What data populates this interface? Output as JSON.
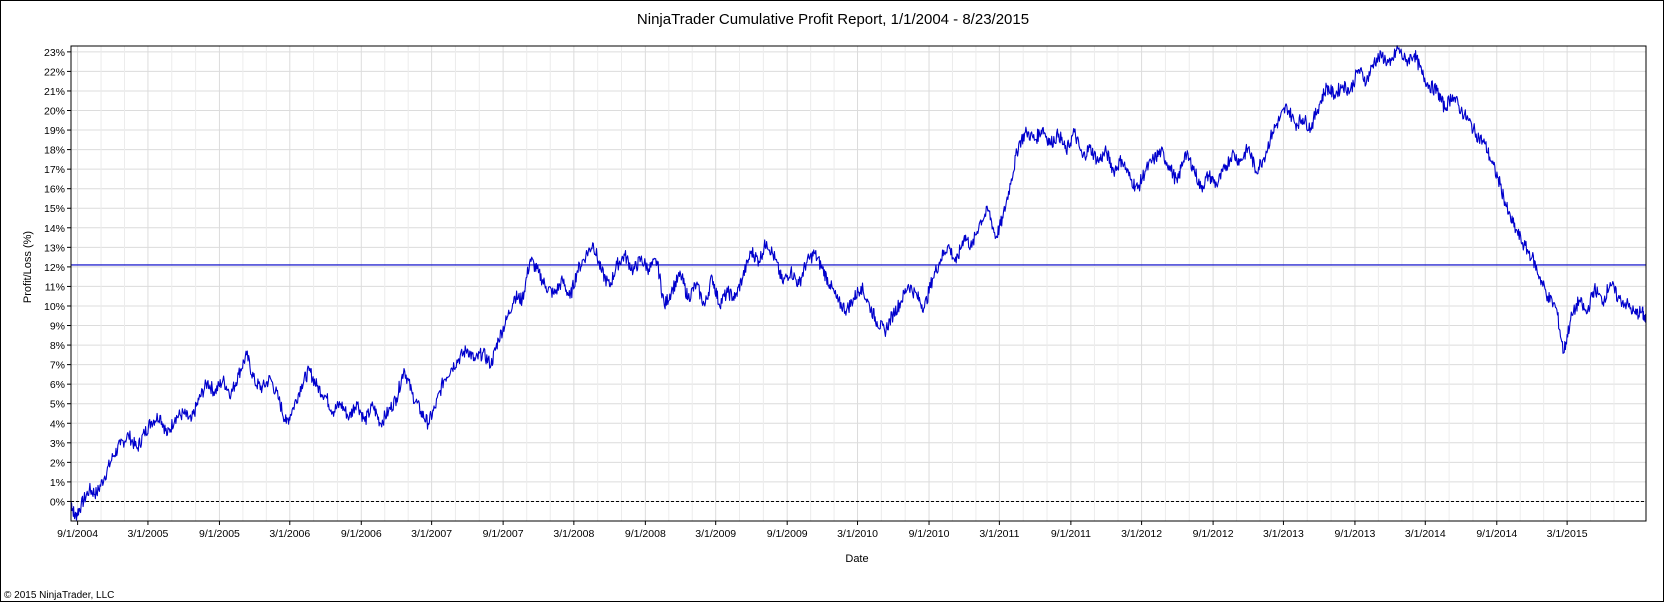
{
  "chart_data": {
    "type": "line",
    "title": "NinjaTrader Cumulative Profit Report, 1/1/2004 - 8/23/2015",
    "xlabel": "Date",
    "ylabel": "Profit/Loss (%)",
    "ylim": [
      -1,
      23.3
    ],
    "xlim": [
      "2004-08-15",
      "2015-09-20"
    ],
    "grid": true,
    "legend": "none",
    "x_ticks": [
      "9/1/2004",
      "3/1/2005",
      "9/1/2005",
      "3/1/2006",
      "9/1/2006",
      "3/1/2007",
      "9/1/2007",
      "3/1/2008",
      "9/1/2008",
      "3/1/2009",
      "9/1/2009",
      "3/1/2010",
      "9/1/2010",
      "3/1/2011",
      "9/1/2011",
      "3/1/2012",
      "9/1/2012",
      "3/1/2013",
      "9/1/2013",
      "3/1/2014",
      "9/1/2014",
      "3/1/2015"
    ],
    "y_ticks": [
      "0%",
      "1%",
      "2%",
      "3%",
      "4%",
      "5%",
      "6%",
      "7%",
      "8%",
      "9%",
      "10%",
      "11%",
      "12%",
      "13%",
      "14%",
      "15%",
      "16%",
      "17%",
      "18%",
      "19%",
      "20%",
      "21%",
      "22%",
      "23%"
    ],
    "reference_lines": [
      {
        "value": 12.1,
        "style": "solid",
        "color": "#2b2bd0"
      },
      {
        "value": 0,
        "style": "dashed",
        "color": "#000000"
      }
    ],
    "series": [
      {
        "color": "#0000cc",
        "points": [
          [
            "2004-08-15",
            0.0
          ],
          [
            "2004-08-25",
            -0.8
          ],
          [
            "2004-09-10",
            -0.2
          ],
          [
            "2004-10-01",
            0.6
          ],
          [
            "2004-10-20",
            0.4
          ],
          [
            "2004-11-10",
            1.3
          ],
          [
            "2004-12-01",
            2.3
          ],
          [
            "2004-12-20",
            2.9
          ],
          [
            "2005-01-10",
            3.4
          ],
          [
            "2005-02-01",
            2.7
          ],
          [
            "2005-02-20",
            3.5
          ],
          [
            "2005-03-10",
            4.1
          ],
          [
            "2005-04-01",
            4.4
          ],
          [
            "2005-04-20",
            3.4
          ],
          [
            "2005-05-10",
            4.3
          ],
          [
            "2005-06-01",
            4.5
          ],
          [
            "2005-06-20",
            4.1
          ],
          [
            "2005-07-10",
            5.2
          ],
          [
            "2005-08-01",
            6.1
          ],
          [
            "2005-08-20",
            5.6
          ],
          [
            "2005-09-10",
            6.2
          ],
          [
            "2005-10-01",
            5.5
          ],
          [
            "2005-10-20",
            6.5
          ],
          [
            "2005-11-10",
            7.5
          ],
          [
            "2005-12-01",
            6.1
          ],
          [
            "2005-12-20",
            5.8
          ],
          [
            "2006-01-10",
            6.3
          ],
          [
            "2006-02-01",
            5.2
          ],
          [
            "2006-02-20",
            4.0
          ],
          [
            "2006-03-10",
            4.8
          ],
          [
            "2006-04-01",
            6.0
          ],
          [
            "2006-04-20",
            6.7
          ],
          [
            "2006-05-10",
            5.9
          ],
          [
            "2006-06-01",
            5.4
          ],
          [
            "2006-06-20",
            4.6
          ],
          [
            "2006-07-10",
            5.0
          ],
          [
            "2006-08-01",
            4.3
          ],
          [
            "2006-08-20",
            5.1
          ],
          [
            "2006-09-10",
            4.1
          ],
          [
            "2006-10-01",
            4.9
          ],
          [
            "2006-10-20",
            4.0
          ],
          [
            "2006-11-10",
            4.6
          ],
          [
            "2006-12-01",
            5.3
          ],
          [
            "2006-12-20",
            6.8
          ],
          [
            "2007-01-10",
            5.5
          ],
          [
            "2007-02-01",
            4.6
          ],
          [
            "2007-02-20",
            4.0
          ],
          [
            "2007-03-10",
            4.8
          ],
          [
            "2007-04-01",
            6.2
          ],
          [
            "2007-04-20",
            6.8
          ],
          [
            "2007-05-10",
            7.3
          ],
          [
            "2007-06-01",
            7.8
          ],
          [
            "2007-06-20",
            7.2
          ],
          [
            "2007-07-10",
            7.6
          ],
          [
            "2007-08-01",
            7.0
          ],
          [
            "2007-08-20",
            8.3
          ],
          [
            "2007-09-10",
            9.3
          ],
          [
            "2007-10-01",
            10.5
          ],
          [
            "2007-10-20",
            10.3
          ],
          [
            "2007-11-10",
            12.4
          ],
          [
            "2007-12-01",
            11.7
          ],
          [
            "2007-12-20",
            11.0
          ],
          [
            "2008-01-10",
            10.6
          ],
          [
            "2008-02-01",
            11.3
          ],
          [
            "2008-02-20",
            10.4
          ],
          [
            "2008-03-10",
            11.8
          ],
          [
            "2008-04-01",
            12.6
          ],
          [
            "2008-04-20",
            13.2
          ],
          [
            "2008-05-10",
            11.8
          ],
          [
            "2008-06-01",
            11.0
          ],
          [
            "2008-06-20",
            12.1
          ],
          [
            "2008-07-10",
            12.6
          ],
          [
            "2008-08-01",
            11.8
          ],
          [
            "2008-08-20",
            12.4
          ],
          [
            "2008-09-10",
            11.9
          ],
          [
            "2008-10-01",
            12.3
          ],
          [
            "2008-10-20",
            10.0
          ],
          [
            "2008-11-10",
            10.9
          ],
          [
            "2008-12-01",
            11.6
          ],
          [
            "2008-12-20",
            10.4
          ],
          [
            "2009-01-10",
            11.1
          ],
          [
            "2009-02-01",
            10.0
          ],
          [
            "2009-02-20",
            11.5
          ],
          [
            "2009-03-10",
            10.1
          ],
          [
            "2009-04-01",
            10.7
          ],
          [
            "2009-04-20",
            10.4
          ],
          [
            "2009-05-10",
            11.5
          ],
          [
            "2009-06-01",
            12.8
          ],
          [
            "2009-06-20",
            12.3
          ],
          [
            "2009-07-10",
            13.3
          ],
          [
            "2009-08-01",
            12.4
          ],
          [
            "2009-08-20",
            11.2
          ],
          [
            "2009-09-10",
            11.8
          ],
          [
            "2009-10-01",
            11.1
          ],
          [
            "2009-10-20",
            12.2
          ],
          [
            "2009-11-10",
            12.7
          ],
          [
            "2009-12-01",
            11.9
          ],
          [
            "2009-12-20",
            11.1
          ],
          [
            "2010-01-10",
            10.2
          ],
          [
            "2010-02-01",
            9.8
          ],
          [
            "2010-02-20",
            10.4
          ],
          [
            "2010-03-10",
            11.0
          ],
          [
            "2010-04-01",
            10.0
          ],
          [
            "2010-04-20",
            9.2
          ],
          [
            "2010-05-10",
            8.7
          ],
          [
            "2010-06-01",
            9.6
          ],
          [
            "2010-06-20",
            10.2
          ],
          [
            "2010-07-10",
            11.1
          ],
          [
            "2010-08-01",
            10.5
          ],
          [
            "2010-08-20",
            9.9
          ],
          [
            "2010-09-10",
            11.4
          ],
          [
            "2010-10-01",
            12.4
          ],
          [
            "2010-10-20",
            13.1
          ],
          [
            "2010-11-10",
            12.2
          ],
          [
            "2010-12-01",
            13.6
          ],
          [
            "2010-12-20",
            13.0
          ],
          [
            "2011-01-10",
            14.3
          ],
          [
            "2011-02-01",
            14.9
          ],
          [
            "2011-02-20",
            13.5
          ],
          [
            "2011-03-10",
            14.5
          ],
          [
            "2011-04-01",
            16.5
          ],
          [
            "2011-04-20",
            18.3
          ],
          [
            "2011-05-10",
            18.9
          ],
          [
            "2011-06-01",
            18.5
          ],
          [
            "2011-06-20",
            19.1
          ],
          [
            "2011-07-10",
            18.3
          ],
          [
            "2011-08-01",
            18.8
          ],
          [
            "2011-08-20",
            17.9
          ],
          [
            "2011-09-10",
            18.9
          ],
          [
            "2011-10-01",
            17.6
          ],
          [
            "2011-10-20",
            18.1
          ],
          [
            "2011-11-10",
            17.4
          ],
          [
            "2011-12-01",
            17.9
          ],
          [
            "2011-12-20",
            16.9
          ],
          [
            "2012-01-10",
            17.5
          ],
          [
            "2012-02-01",
            16.5
          ],
          [
            "2012-02-20",
            16.0
          ],
          [
            "2012-03-10",
            16.9
          ],
          [
            "2012-04-01",
            17.5
          ],
          [
            "2012-04-20",
            17.9
          ],
          [
            "2012-05-10",
            17.2
          ],
          [
            "2012-06-01",
            16.3
          ],
          [
            "2012-06-20",
            17.8
          ],
          [
            "2012-07-10",
            17.2
          ],
          [
            "2012-08-01",
            16.0
          ],
          [
            "2012-08-20",
            16.7
          ],
          [
            "2012-09-10",
            16.2
          ],
          [
            "2012-10-01",
            17.0
          ],
          [
            "2012-10-20",
            17.8
          ],
          [
            "2012-11-10",
            17.4
          ],
          [
            "2012-12-01",
            18.1
          ],
          [
            "2012-12-20",
            16.9
          ],
          [
            "2013-01-10",
            17.6
          ],
          [
            "2013-02-01",
            18.9
          ],
          [
            "2013-02-20",
            19.6
          ],
          [
            "2013-03-10",
            20.2
          ],
          [
            "2013-04-01",
            19.3
          ],
          [
            "2013-04-20",
            19.6
          ],
          [
            "2013-05-10",
            19.1
          ],
          [
            "2013-06-01",
            20.3
          ],
          [
            "2013-06-20",
            21.2
          ],
          [
            "2013-07-10",
            20.8
          ],
          [
            "2013-08-01",
            21.3
          ],
          [
            "2013-08-20",
            21.0
          ],
          [
            "2013-09-10",
            22.1
          ],
          [
            "2013-10-01",
            21.5
          ],
          [
            "2013-10-20",
            22.5
          ],
          [
            "2013-11-10",
            22.8
          ],
          [
            "2013-12-01",
            22.3
          ],
          [
            "2013-12-20",
            23.2
          ],
          [
            "2014-01-10",
            22.5
          ],
          [
            "2014-02-01",
            22.9
          ],
          [
            "2014-02-20",
            21.9
          ],
          [
            "2014-03-10",
            21.3
          ],
          [
            "2014-04-01",
            21.0
          ],
          [
            "2014-04-20",
            20.1
          ],
          [
            "2014-05-10",
            20.8
          ],
          [
            "2014-06-01",
            20.0
          ],
          [
            "2014-06-20",
            19.5
          ],
          [
            "2014-07-10",
            18.8
          ],
          [
            "2014-08-01",
            18.3
          ],
          [
            "2014-08-20",
            17.3
          ],
          [
            "2014-09-10",
            16.2
          ],
          [
            "2014-10-01",
            14.7
          ],
          [
            "2014-10-20",
            13.9
          ],
          [
            "2014-11-10",
            13.1
          ],
          [
            "2014-12-01",
            12.5
          ],
          [
            "2014-12-20",
            11.5
          ],
          [
            "2015-01-10",
            10.5
          ],
          [
            "2015-02-01",
            9.9
          ],
          [
            "2015-02-20",
            7.6
          ],
          [
            "2015-03-10",
            9.3
          ],
          [
            "2015-04-01",
            10.3
          ],
          [
            "2015-04-20",
            9.6
          ],
          [
            "2015-05-10",
            10.9
          ],
          [
            "2015-06-01",
            10.2
          ],
          [
            "2015-06-20",
            11.2
          ],
          [
            "2015-07-10",
            10.4
          ],
          [
            "2015-08-01",
            10.1
          ],
          [
            "2015-08-23",
            9.6
          ],
          [
            "2015-09-10",
            9.7
          ],
          [
            "2015-09-20",
            9.2
          ]
        ]
      }
    ]
  },
  "footer": {
    "copyright": "© 2015 NinjaTrader, LLC"
  }
}
